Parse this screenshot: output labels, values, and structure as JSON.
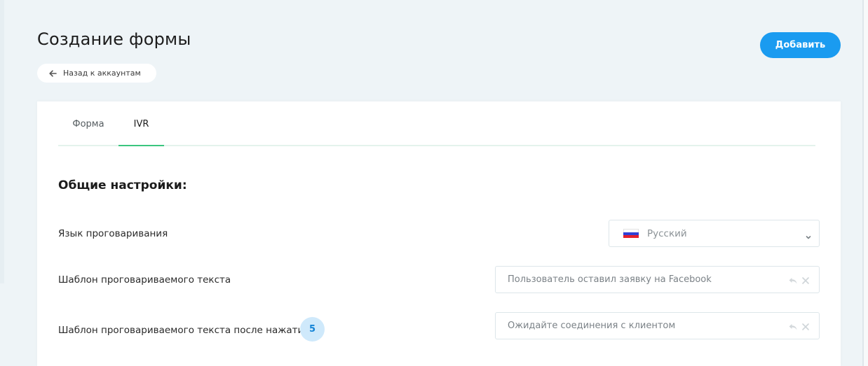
{
  "page": {
    "title": "Создание формы",
    "back_label": "Назад к аккаунтам",
    "add_label": "Добавить"
  },
  "tabs": [
    {
      "label": "Форма",
      "active": false
    },
    {
      "label": "IVR",
      "active": true
    }
  ],
  "section": {
    "title": "Общие настройки:"
  },
  "fields": {
    "language": {
      "label": "Язык проговаривания",
      "value": "Русский",
      "flag_icon": "russia-flag-icon"
    },
    "template": {
      "label": "Шаблон проговариваемого текста",
      "value": "Пользователь оставил заявку на Facebook"
    },
    "template_after": {
      "label": "Шаблон проговариваемого текста после нажатия",
      "badge": "5",
      "value": "Ожидайте соединения с клиентом"
    }
  },
  "colors": {
    "background": "#eef4f7",
    "accent": "#1a9bf0",
    "tab_active_underline": "#3bc57f",
    "badge_bg": "#cfe9fb",
    "badge_text": "#1383d6"
  }
}
